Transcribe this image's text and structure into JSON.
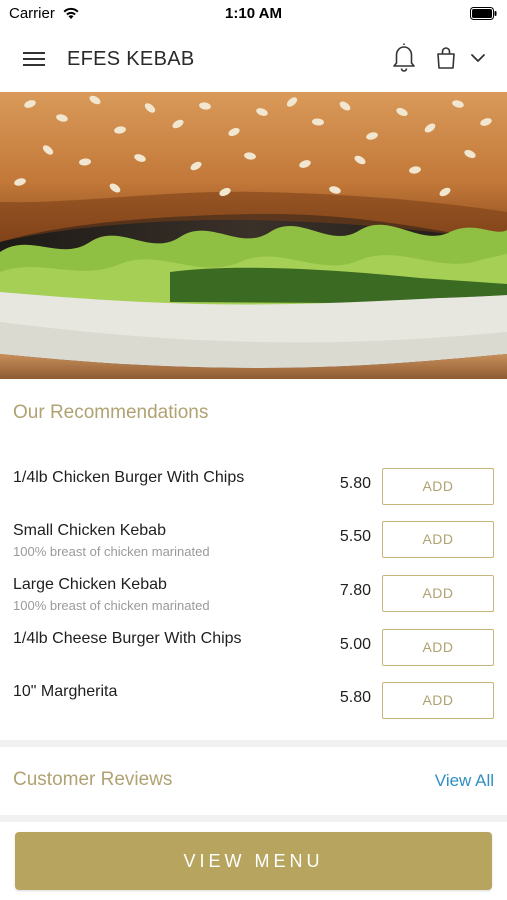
{
  "status_bar": {
    "carrier": "Carrier",
    "time": "1:10 AM"
  },
  "header": {
    "title": "EFES KEBAB",
    "icons": [
      "menu-icon",
      "bell-icon",
      "shopping-bag-icon",
      "chevron-down-icon"
    ]
  },
  "recommendations": {
    "title": "Our Recommendations",
    "add_label": "ADD",
    "items": [
      {
        "name": "1/4lb Chicken Burger With Chips",
        "description": "",
        "price": "5.80"
      },
      {
        "name": "Small Chicken Kebab",
        "description": "100% breast of chicken marinated",
        "price": "5.50"
      },
      {
        "name": "Large Chicken Kebab",
        "description": "100% breast of chicken marinated",
        "price": "7.80"
      },
      {
        "name": "1/4lb Cheese Burger With Chips",
        "description": "",
        "price": "5.00"
      },
      {
        "name": "10\" Margherita",
        "description": "",
        "price": "5.80"
      }
    ]
  },
  "reviews": {
    "title": "Customer Reviews",
    "view_all": "View All"
  },
  "cta": {
    "label": "VIEW MENU"
  },
  "colors": {
    "accent_gold": "#b7a55f",
    "heading_gold": "#b0a272",
    "link_blue": "#2f8fc4"
  }
}
